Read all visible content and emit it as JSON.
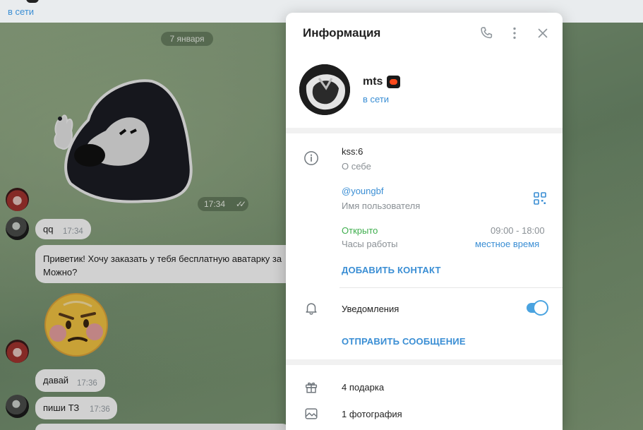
{
  "header": {
    "status": "в сети"
  },
  "chat": {
    "date": "7 января",
    "sticker_time": "17:34",
    "messages": [
      {
        "text": "qq",
        "time": "17:34"
      },
      {
        "text_line1": "Приветик! Хочу заказать у тебя бесплатную аватарку за",
        "text_line2": "Можно?"
      },
      {
        "text": "давай",
        "time": "17:36"
      },
      {
        "text": "пиши ТЗ",
        "time": "17:36"
      }
    ]
  },
  "panel": {
    "title": "Информация",
    "profile": {
      "name": "mts",
      "status": "в сети"
    },
    "bio": {
      "value": "kss:6",
      "label": "О себе"
    },
    "username": {
      "value": "@youngbf",
      "label": "Имя пользователя"
    },
    "hours": {
      "status": "Открыто",
      "label": "Часы работы",
      "range": "09:00 - 18:00",
      "local": "местное время"
    },
    "add_contact": "ДОБАВИТЬ КОНТАКТ",
    "notifications": {
      "label": "Уведомления",
      "enabled": true
    },
    "send_message": "ОТПРАВИТЬ СООБЩЕНИЕ",
    "gifts": "4 подарка",
    "photos": "1 фотография"
  },
  "colors": {
    "accent": "#3a8ed4",
    "open_green": "#3fae4e",
    "badge": "#ff4a1c"
  }
}
